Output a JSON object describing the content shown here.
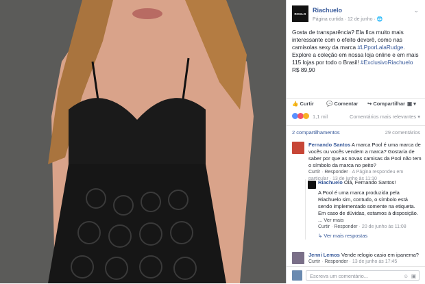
{
  "post": {
    "page_name": "Riachuelo",
    "meta": "Página curtida · 12 de junho · ",
    "logo_text": "RCHLO",
    "text": "Gosta de transparência? Ela fica muito mais interessante com o efeito devorê, como nas camisolas sexy da marca ",
    "hashtag1": "#LPporLalaRudge",
    "text2": ". Explore a coleção em nossa loja online e em mais 115 lojas por todo o Brasil! ",
    "hashtag2": "#ExclusivoRiachuelo",
    "text3": " R$ 89,90"
  },
  "actions": {
    "like": "Curtir",
    "comment": "Comentar",
    "share": "Compartilhar"
  },
  "reactions": {
    "count": "1,1 mil",
    "relevance": "Comentários mais relevantes ▾"
  },
  "stats": {
    "shares": "2 compartilhamentos",
    "comments": "29 comentários"
  },
  "comments": [
    {
      "author": "Fernando Santos",
      "text": " A marca Pool é uma marca de vocês ou vocês vendem a marca? Gostaria de saber por que as novas camisas da Pool não tem o símbolo da marca no peito?",
      "like": "Curtir",
      "reply": "Responder",
      "meta1": " · A Página respondeu em particular · 13 de junho às 11:10"
    },
    {
      "author": "Jenni Lemos",
      "text": " Vende relogio casio em ipanema?",
      "like": "Curtir",
      "reply": "Responder",
      "meta1": " · 13 de junho às 17:45"
    }
  ],
  "reply": {
    "author": "Riachuelo",
    "text": " Olá, Fernando Santos!",
    "body": "A Pool é uma marca produzida pela Riachuelo sim, contudo, o símbolo está sendo implementado somente na etiqueta. Em caso de dúvidas, estamos à disposição.",
    "see_more": "... Ver mais",
    "like": "Curtir",
    "reply_label": "Responder",
    "meta": " · 20 de junho às 11:08",
    "more_replies": "Ver mais respostas"
  },
  "input": {
    "placeholder": "Escreva um comentário..."
  }
}
